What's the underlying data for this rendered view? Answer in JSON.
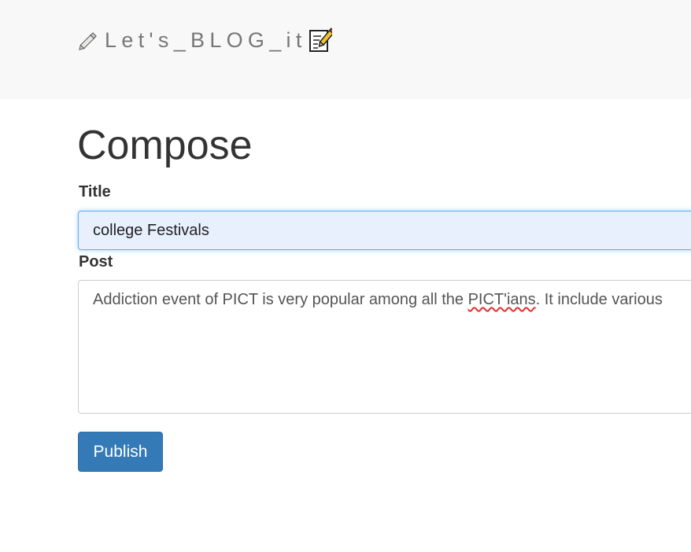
{
  "navbar": {
    "brand_text": "Let's_BLOG_it",
    "brand_left_icon": "pencil-icon",
    "brand_right_icon": "memo-icon"
  },
  "compose": {
    "heading": "Compose",
    "title_label": "Title",
    "title_value": "college Festivals",
    "post_label": "Post",
    "post_text_before": "Addiction event of PICT is very popular among all the ",
    "post_text_misspelled": "PICT'ians",
    "post_text_after": ". It include various",
    "publish_label": "Publish"
  },
  "colors": {
    "navbar_bg": "#f8f8f8",
    "brand_text": "#777777",
    "primary_button": "#337ab7",
    "focused_input_bg": "#e8f0fe",
    "focus_border": "#66afe9"
  }
}
